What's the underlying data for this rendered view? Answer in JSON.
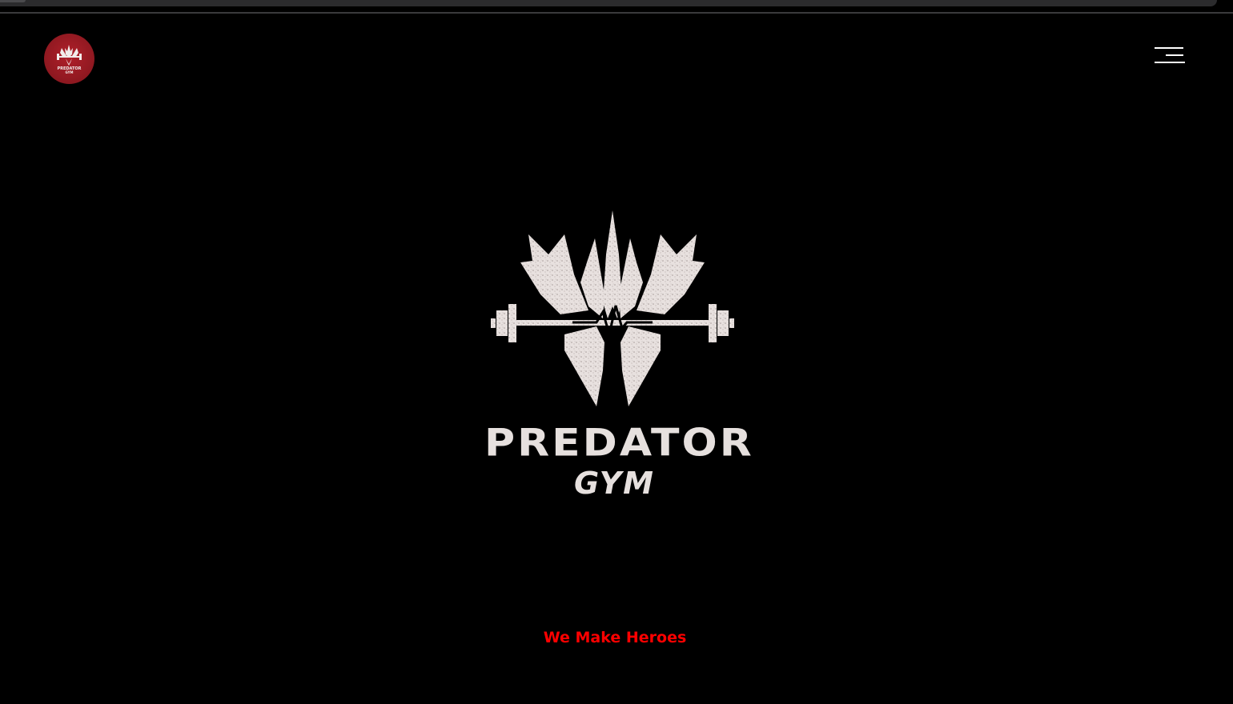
{
  "nav": {
    "logo_icon": "predator-gym-logo",
    "logo_text": "PREDATOR",
    "logo_sub": "GYM",
    "menu_icon": "hamburger-menu-icon"
  },
  "hero": {
    "logo_icon": "predator-emblem-barbell",
    "brand_name": "PREDATOR",
    "brand_sub": "GYM",
    "tagline": "We Make Heroes"
  },
  "colors": {
    "background": "#000000",
    "accent": "#ff0000",
    "logo_badge": "#9a1a22",
    "logo_light": "#e6e0de"
  }
}
